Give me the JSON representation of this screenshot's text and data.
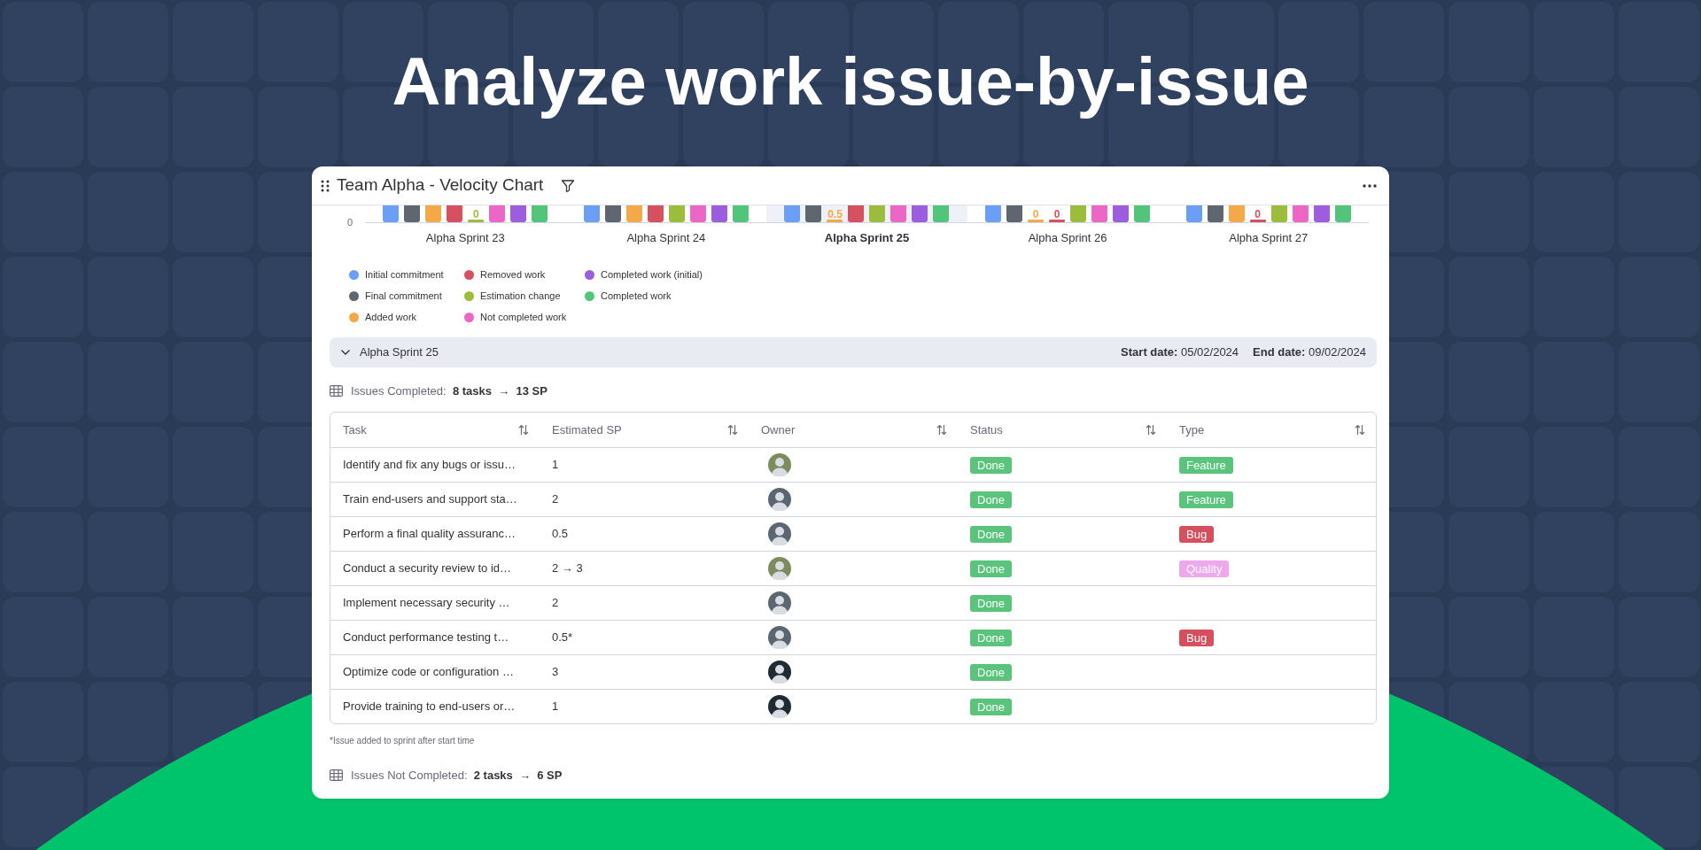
{
  "headline": "Analyze work issue-by-issue",
  "window": {
    "title": "Team Alpha - Velocity Chart"
  },
  "chart": {
    "y_tick": "0",
    "groups": [
      {
        "label": "Alpha Sprint 23",
        "selected": false,
        "bars": [
          {
            "color": "#6b9ff5"
          },
          {
            "color": "#5f6670"
          },
          {
            "color": "#f4a949"
          },
          {
            "color": "#d7505f"
          },
          {
            "color": "#9cbc3c",
            "label": "0"
          },
          {
            "color": "#ec66c6"
          },
          {
            "color": "#9c5ede"
          },
          {
            "color": "#53c57a"
          }
        ]
      },
      {
        "label": "Alpha Sprint 24",
        "selected": false,
        "bars": [
          {
            "color": "#6b9ff5"
          },
          {
            "color": "#5f6670"
          },
          {
            "color": "#f4a949"
          },
          {
            "color": "#d7505f"
          },
          {
            "color": "#9cbc3c"
          },
          {
            "color": "#ec66c6"
          },
          {
            "color": "#9c5ede"
          },
          {
            "color": "#53c57a"
          }
        ]
      },
      {
        "label": "Alpha Sprint 25",
        "selected": true,
        "bars": [
          {
            "color": "#6b9ff5"
          },
          {
            "color": "#5f6670"
          },
          {
            "color": "#f4a949",
            "label": "0.5"
          },
          {
            "color": "#d7505f"
          },
          {
            "color": "#9cbc3c"
          },
          {
            "color": "#ec66c6"
          },
          {
            "color": "#9c5ede"
          },
          {
            "color": "#53c57a"
          }
        ]
      },
      {
        "label": "Alpha Sprint 26",
        "selected": false,
        "bars": [
          {
            "color": "#6b9ff5"
          },
          {
            "color": "#5f6670"
          },
          {
            "color": "#f4a949",
            "label": "0"
          },
          {
            "color": "#d7505f",
            "label": "0"
          },
          {
            "color": "#9cbc3c"
          },
          {
            "color": "#ec66c6"
          },
          {
            "color": "#9c5ede"
          },
          {
            "color": "#53c57a"
          }
        ]
      },
      {
        "label": "Alpha Sprint 27",
        "selected": false,
        "bars": [
          {
            "color": "#6b9ff5"
          },
          {
            "color": "#5f6670"
          },
          {
            "color": "#f4a949"
          },
          {
            "color": "#d7505f",
            "label": "0"
          },
          {
            "color": "#9cbc3c"
          },
          {
            "color": "#ec66c6"
          },
          {
            "color": "#9c5ede"
          },
          {
            "color": "#53c57a"
          }
        ]
      }
    ]
  },
  "legend": [
    {
      "label": "Initial commitment",
      "color": "#6b9ff5"
    },
    {
      "label": "Final commitment",
      "color": "#5f6670"
    },
    {
      "label": "Added work",
      "color": "#f4a949"
    },
    {
      "label": "Removed work",
      "color": "#d7505f"
    },
    {
      "label": "Estimation change",
      "color": "#9cbc3c"
    },
    {
      "label": "Not completed work",
      "color": "#ec66c6"
    },
    {
      "label": "Completed work (initial)",
      "color": "#9c5ede"
    },
    {
      "label": "Completed work",
      "color": "#53c57a"
    }
  ],
  "sprint": {
    "name": "Alpha Sprint 25",
    "expanded": true,
    "start": "**Start date:** 05/02/2024",
    "end": "**End date:** 09/02/2024"
  },
  "completed": {
    "summary": "Issues Completed:  **8 tasks  →  13 SP**"
  },
  "table": {
    "columns": [
      "Task",
      "Estimated SP",
      "Owner",
      "Status",
      "Type"
    ],
    "rows": [
      {
        "task": "Identify and fix any bugs or issu…",
        "sp": "1",
        "owner": {
          "color": "#7d8b5e"
        },
        "status": {
          "text": "Done",
          "color": "#5ac47d"
        },
        "type": {
          "text": "Feature",
          "color": "#5ac47d"
        }
      },
      {
        "task": "Train end-users and support sta…",
        "sp": "2",
        "owner": {
          "color": "#5b6770"
        },
        "status": {
          "text": "Done",
          "color": "#5ac47d"
        },
        "type": {
          "text": "Feature",
          "color": "#5ac47d"
        }
      },
      {
        "task": "Perform a final quality assuranc…",
        "sp": "0.5",
        "owner": {
          "color": "#5b6770"
        },
        "status": {
          "text": "Done",
          "color": "#5ac47d"
        },
        "type": {
          "text": "Bug",
          "color": "#d64f5f"
        }
      },
      {
        "task": "Conduct a security review to id…",
        "sp": "2 → 3",
        "owner": {
          "color": "#7d8b5e"
        },
        "status": {
          "text": "Done",
          "color": "#5ac47d"
        },
        "type": {
          "text": "Quality",
          "color": "#eea9ec"
        }
      },
      {
        "task": "Implement necessary security …",
        "sp": "2",
        "owner": {
          "color": "#5b6770"
        },
        "status": {
          "text": "Done",
          "color": "#5ac47d"
        }
      },
      {
        "task": "Conduct performance testing t…",
        "sp": "0.5*",
        "owner": {
          "color": "#5b6770"
        },
        "status": {
          "text": "Done",
          "color": "#5ac47d"
        },
        "type": {
          "text": "Bug",
          "color": "#d64f5f"
        }
      },
      {
        "task": "Optimize code or configuration …",
        "sp": "3",
        "owner": {
          "color": "#1f2a33"
        },
        "status": {
          "text": "Done",
          "color": "#5ac47d"
        }
      },
      {
        "task": "Provide training to end-users or…",
        "sp": "1",
        "owner": {
          "color": "#1f2a33"
        },
        "status": {
          "text": "Done",
          "color": "#5ac47d"
        }
      }
    ]
  },
  "footnote": "*Issue added to sprint after start time",
  "not_completed": {
    "summary": "Issues Not Completed:  **2 tasks  →  6 SP**"
  }
}
